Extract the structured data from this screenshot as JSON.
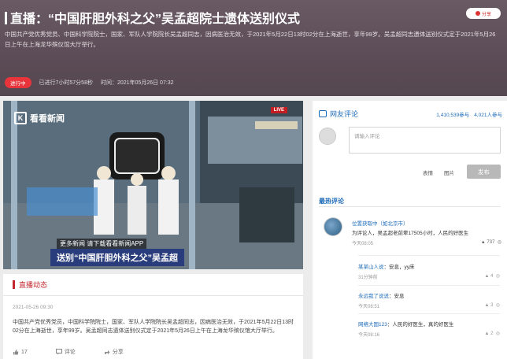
{
  "header": {
    "title": "直播：“中国肝胆外科之父”吴孟超院士遗体送别仪式",
    "share_label": "分享",
    "description": "中国共产党优秀党员、中国科学院院士，国家、军队人学院院长吴孟超同志，因病医治无效，于2021年5月22日13时02分在上海逝世，享年99岁。吴孟超同志遗体送别仪式定于2021年5月26日上午在上海龙华殡仪馆大厅举行。",
    "status_badge": "进行中",
    "started": "已进行7小时57分58秒",
    "time": "时间：2021年05月26日 07:32"
  },
  "video": {
    "brand": "看看新闻",
    "live_tag": "LIVE",
    "ticker_small": "更多新闻  请下载看看新闻APP",
    "ticker_big": "送别“中国肝胆外科之父”吴孟超"
  },
  "updates": {
    "title": "直播动态",
    "time": "2021-05-26 09:30",
    "text": "中国共产党优秀党员，中国科学院院士，国家、军队人学院院长吴孟超同志，因病医治无效，于2021年5月22日13时02分在上海逝世，享年99岁。吴孟超同志遗体送别仪式定于2021年5月26日上午在上海龙华殡仪馆大厅举行。",
    "likes": "17",
    "comments_label": "评论",
    "share_label": "分享"
  },
  "comments": {
    "title": "网友评论",
    "count_reads": "1,410,539参与",
    "count_comments": "4,021人参与",
    "input_placeholder": "请输入评论",
    "emoji_label": "表情",
    "image_label": "图片",
    "send_label": "发布",
    "hot_title": "最热评论",
    "items": [
      {
        "user": "位置获取中（如北京市）",
        "text": "为评论人，吴孟超老前辈17505小时，人民的好医生",
        "time": "今天08:05",
        "likes": "737"
      }
    ],
    "replies": [
      {
        "user": "某某山人说",
        "text": "：安息，yy床",
        "time": "31分钟前",
        "likes": "4"
      },
      {
        "user": "永远我了说说",
        "text": "：安息",
        "time": "今天08:51",
        "likes": "3"
      },
      {
        "user": "网络大国123",
        "text": "：人民的好医生，真的好医生",
        "time": "今天08:16",
        "likes": "2"
      }
    ]
  }
}
